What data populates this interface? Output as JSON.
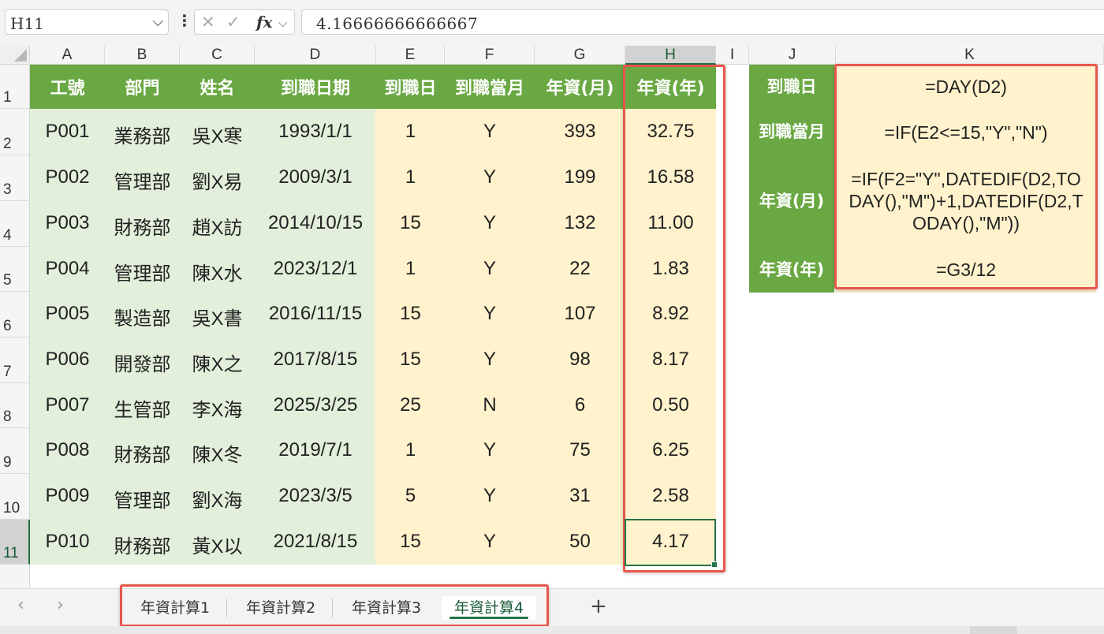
{
  "name_box": "H11",
  "formula_bar": {
    "value": "4.16666666666667",
    "cancel_icon": "x-icon",
    "enter_icon": "check-icon",
    "fx_label": "fx"
  },
  "columns": [
    "A",
    "B",
    "C",
    "D",
    "E",
    "F",
    "G",
    "H",
    "I",
    "J",
    "K"
  ],
  "rows": [
    "1",
    "2",
    "3",
    "4",
    "5",
    "6",
    "7",
    "8",
    "9",
    "10",
    "11"
  ],
  "table": {
    "headers": [
      "工號",
      "部門",
      "姓名",
      "到職日期",
      "到職日",
      "到職當月",
      "年資(月)",
      "年資(年)"
    ],
    "rows": [
      [
        "P001",
        "業務部",
        "吳X寒",
        "1993/1/1",
        "1",
        "Y",
        "393",
        "32.75"
      ],
      [
        "P002",
        "管理部",
        "劉X易",
        "2009/3/1",
        "1",
        "Y",
        "199",
        "16.58"
      ],
      [
        "P003",
        "財務部",
        "趙X訪",
        "2014/10/15",
        "15",
        "Y",
        "132",
        "11.00"
      ],
      [
        "P004",
        "管理部",
        "陳X水",
        "2023/12/1",
        "1",
        "Y",
        "22",
        "1.83"
      ],
      [
        "P005",
        "製造部",
        "吳X書",
        "2016/11/15",
        "15",
        "Y",
        "107",
        "8.92"
      ],
      [
        "P006",
        "開發部",
        "陳X之",
        "2017/8/15",
        "15",
        "Y",
        "98",
        "8.17"
      ],
      [
        "P007",
        "生管部",
        "李X海",
        "2025/3/25",
        "25",
        "N",
        "6",
        "0.50"
      ],
      [
        "P008",
        "財務部",
        "陳X冬",
        "2019/7/1",
        "1",
        "Y",
        "75",
        "6.25"
      ],
      [
        "P009",
        "管理部",
        "劉X海",
        "2023/3/5",
        "5",
        "Y",
        "31",
        "2.58"
      ],
      [
        "P010",
        "財務部",
        "黃X以",
        "2021/8/15",
        "15",
        "Y",
        "50",
        "4.17"
      ]
    ]
  },
  "formulas": {
    "labels": [
      "到職日",
      "到職當月",
      "年資(月)",
      "年資(年)"
    ],
    "values": [
      "=DAY(D2)",
      "=IF(E2<=15,\"Y\",\"N\")",
      [
        "=IF(F2=\"Y\",DATEDIF(D2,TO",
        "DAY(),\"M\")+1,DATEDIF(D2,T",
        "ODAY(),\"M\"))"
      ],
      "=G3/12"
    ]
  },
  "sheets": {
    "tabs": [
      "年資計算1",
      "年資計算2",
      "年資計算3",
      "年資計算4"
    ],
    "active_index": 3,
    "add_label": "+"
  },
  "colors": {
    "header_green": "#6aa843",
    "light_green": "#e2efda",
    "light_yellow": "#fff2cc",
    "highlight_red": "#e8574c",
    "selection_green": "#217346"
  }
}
